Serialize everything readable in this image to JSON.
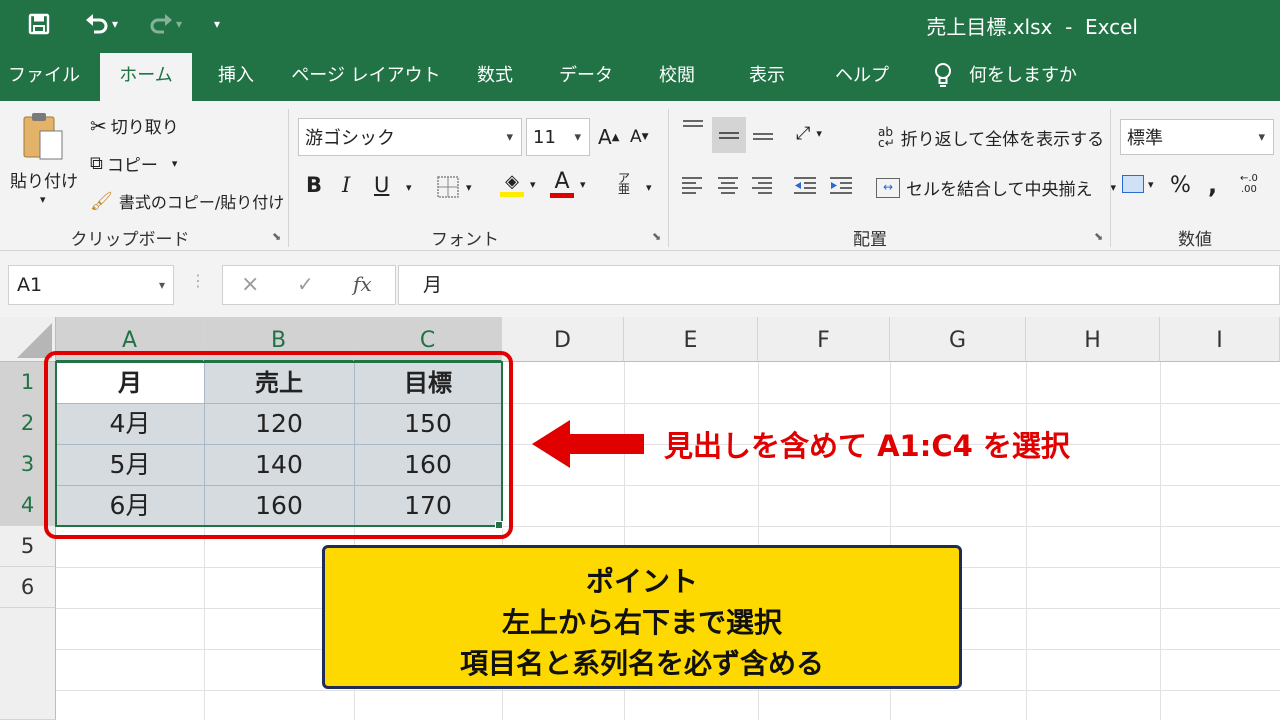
{
  "titlebar": {
    "title": "売上目標.xlsx  -  Excel",
    "bg_color": "#217346",
    "save_icon": "save-icon",
    "undo_icon": "undo-icon",
    "redo_icon": "redo-icon",
    "customize_icon": "customize-quick-access-icon"
  },
  "tabs": {
    "file": "ファイル",
    "home": "ホーム",
    "insert": "挿入",
    "page_layout": "ページ レイアウト",
    "formulas": "数式",
    "data": "データ",
    "review": "校閲",
    "view": "表示",
    "help": "ヘルプ",
    "tell_me": "何をしますか"
  },
  "clipboard": {
    "paste": "貼り付け",
    "cut": "切り取り",
    "copy": "コピー",
    "format_painter": "書式のコピー/貼り付け",
    "label": "クリップボード"
  },
  "font": {
    "family": "游ゴシック",
    "size": "11",
    "bold": "B",
    "italic": "I",
    "underline": "U",
    "grow": "A",
    "shrink": "A",
    "font_color": "A",
    "phonetic": "ア",
    "label": "フォント",
    "highlight_color": "#ffeb00",
    "font_color_bar": "#e00000"
  },
  "alignment": {
    "wrap_text": "折り返して全体を表示する",
    "merge_center": "セルを結合して中央揃え",
    "label": "配置"
  },
  "number": {
    "format": "標準",
    "percent": "%",
    "comma": ",",
    "label": "数値"
  },
  "formula_bar": {
    "name_box": "A1",
    "cancel": "×",
    "enter": "✓",
    "fx": "fx",
    "content": "月"
  },
  "sheet": {
    "columns": [
      "A",
      "B",
      "C",
      "D",
      "E",
      "F",
      "G",
      "H",
      "I"
    ],
    "rows": [
      "1",
      "2",
      "3",
      "4",
      "5",
      "6"
    ],
    "header": [
      "月",
      "売上",
      "目標"
    ],
    "data": [
      [
        "4月",
        "120",
        "150"
      ],
      [
        "5月",
        "140",
        "160"
      ],
      [
        "6月",
        "160",
        "170"
      ]
    ],
    "selection_color": "#217346",
    "selected_fill": "#d6dbe0"
  },
  "annotation": {
    "arrow_label": "見出しを含めて A1:C4 を選択",
    "color": "#e00000"
  },
  "callout": {
    "line1": "ポイント",
    "line2": "左上から右下まで選択",
    "line3": "項目名と系列名を必ず含める",
    "bg_color": "#fdd900"
  }
}
